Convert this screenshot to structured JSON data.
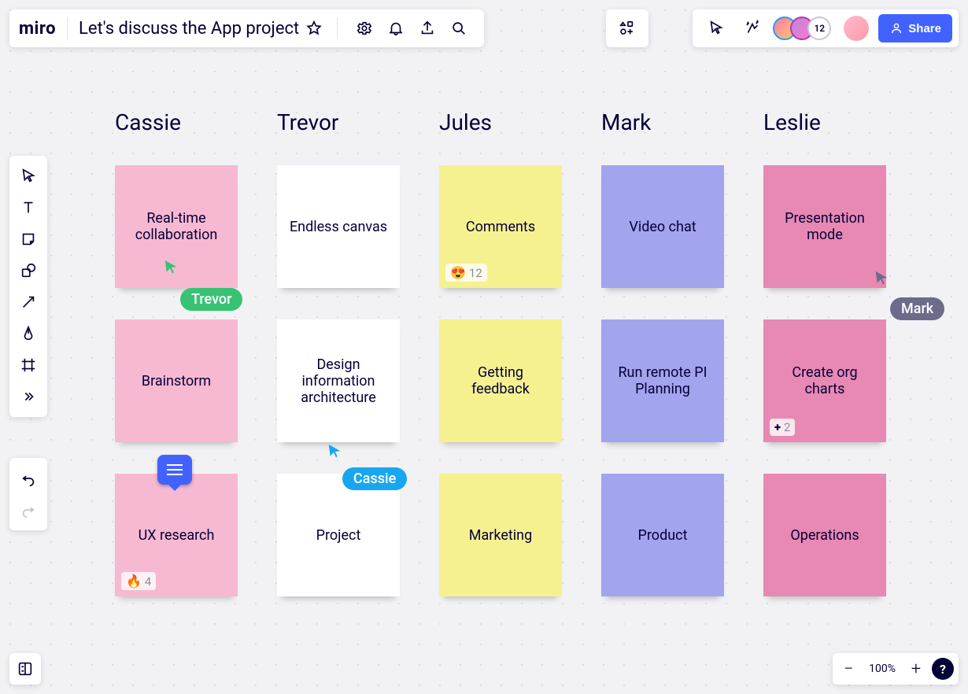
{
  "header": {
    "logo": "miro",
    "board_title": "Let's discuss the App project"
  },
  "presence": {
    "avatar_count": "12",
    "share_label": "Share"
  },
  "cursors": {
    "trevor": "Trevor",
    "cassie": "Cassie",
    "mark": "Mark"
  },
  "zoom": {
    "level": "100%"
  },
  "columns": [
    {
      "name": "Cassie",
      "cards": [
        {
          "text": "Real-time collaboration",
          "color": "pink"
        },
        {
          "text": "Brainstorm",
          "color": "pink"
        },
        {
          "text": "UX research",
          "color": "pink",
          "badge_emoji": "🔥",
          "badge_count": "4",
          "has_comment": true
        }
      ]
    },
    {
      "name": "Trevor",
      "cards": [
        {
          "text": "Endless canvas",
          "color": "whitecard"
        },
        {
          "text": "Design information architecture",
          "color": "whitecard"
        },
        {
          "text": "Project",
          "color": "whitecard"
        }
      ]
    },
    {
      "name": "Jules",
      "cards": [
        {
          "text": "Comments",
          "color": "yellow",
          "badge_emoji": "😍",
          "badge_count": "12"
        },
        {
          "text": "Getting feedback",
          "color": "yellow"
        },
        {
          "text": "Marketing",
          "color": "yellow"
        }
      ]
    },
    {
      "name": "Mark",
      "cards": [
        {
          "text": "Video chat",
          "color": "purple"
        },
        {
          "text": "Run remote PI Planning",
          "color": "purple"
        },
        {
          "text": "Product",
          "color": "purple"
        }
      ]
    },
    {
      "name": "Leslie",
      "cards": [
        {
          "text": "Presentation mode",
          "color": "pinksat"
        },
        {
          "text": "Create org charts",
          "color": "pinksat",
          "badge_plus": true,
          "badge_count": "2"
        },
        {
          "text": "Operations",
          "color": "pinksat"
        }
      ]
    }
  ]
}
